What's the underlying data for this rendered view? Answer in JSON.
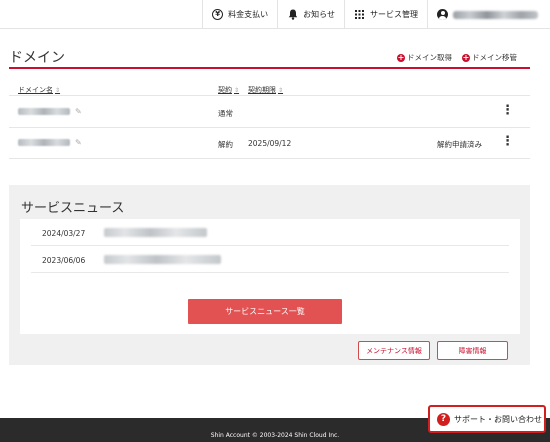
{
  "topbar": {
    "billing_label": "料金支払い",
    "notice_label": "お知らせ",
    "service_label": "サービス管理"
  },
  "domain_section": {
    "title": "ドメイン",
    "acquire_label": "ドメイン取得",
    "transfer_label": "ドメイン移管",
    "columns": {
      "name": "ドメイン名",
      "contract": "契約",
      "expiry": "契約期限"
    },
    "rows": [
      {
        "contract": "通常",
        "expiry": "",
        "status": ""
      },
      {
        "contract": "解約",
        "expiry": "2025/09/12",
        "status": "解約申請済み"
      }
    ]
  },
  "news": {
    "title": "サービスニュース",
    "items": [
      {
        "date": "2024/03/27"
      },
      {
        "date": "2023/06/06"
      }
    ],
    "all_button": "サービスニュース一覧",
    "maintenance_button": "メンテナンス情報",
    "outage_button": "障害情報"
  },
  "footer": {
    "copyright": "Shin Account © 2003-2024 Shin Cloud Inc."
  },
  "support": {
    "label": "サポート・お問い合わせ"
  },
  "colors": {
    "accent": "#c8102e",
    "button_red": "#e25252",
    "footer_bg": "#2b2b2b"
  }
}
